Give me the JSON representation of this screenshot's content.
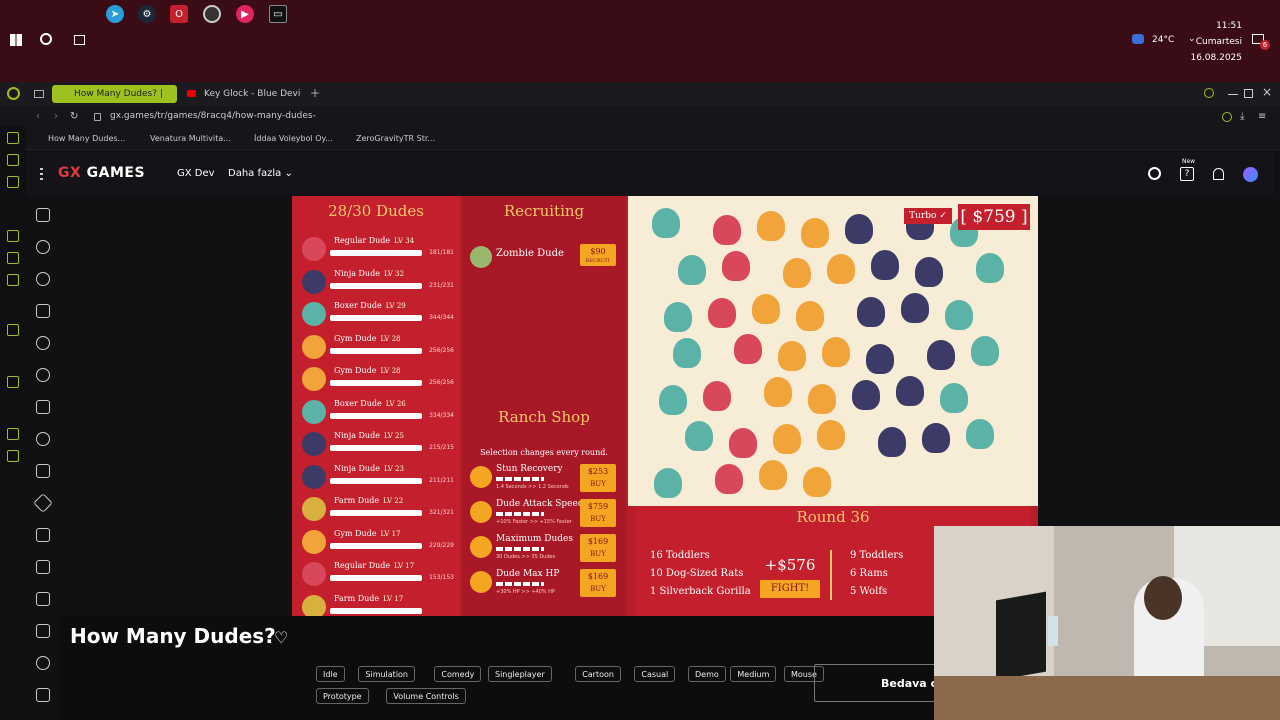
{
  "taskbar": {
    "time": "11:51",
    "day": "Cumartesi",
    "date": "16.08.2025",
    "temperature": "24°C",
    "notif_count": "6"
  },
  "browser": {
    "tabs": [
      {
        "label": "How Many Dudes? |"
      },
      {
        "label": "Key Glock - Blue Devil"
      }
    ],
    "url": "gx.games/tr/games/8racq4/how-many-dudes-",
    "bookmarks": [
      {
        "label": "How Many Dudes..."
      },
      {
        "label": "Venatura Multivita..."
      },
      {
        "label": "İddaa Voleybol Oy..."
      },
      {
        "label": "ZeroGravityTR Str..."
      }
    ]
  },
  "gx_header": {
    "logo_gx": "GX",
    "logo_games": " GAMES",
    "nav": [
      {
        "label": "GX Dev"
      },
      {
        "label": "Daha fazla"
      }
    ],
    "new_badge": "New"
  },
  "game": {
    "dudes_title": "28/30 Dudes",
    "dudes": [
      {
        "name": "Regular Dude",
        "lv": "LV 34",
        "hp": "181/181",
        "color": "#d8485a"
      },
      {
        "name": "Ninja Dude",
        "lv": "LV 32",
        "hp": "231/231",
        "color": "#3c3a66"
      },
      {
        "name": "Boxer Dude",
        "lv": "LV 29",
        "hp": "344/344",
        "color": "#5bb3a8"
      },
      {
        "name": "Gym Dude",
        "lv": "LV 28",
        "hp": "256/256",
        "color": "#f0a43a"
      },
      {
        "name": "Gym Dude",
        "lv": "LV 28",
        "hp": "256/256",
        "color": "#f0a43a"
      },
      {
        "name": "Boxer Dude",
        "lv": "LV 26",
        "hp": "334/334",
        "color": "#5bb3a8"
      },
      {
        "name": "Ninja Dude",
        "lv": "LV 25",
        "hp": "215/215",
        "color": "#3c3a66"
      },
      {
        "name": "Ninja Dude",
        "lv": "LV 23",
        "hp": "211/211",
        "color": "#3c3a66"
      },
      {
        "name": "Farm Dude",
        "lv": "LV 22",
        "hp": "321/321",
        "color": "#d8b040"
      },
      {
        "name": "Gym Dude",
        "lv": "LV 17",
        "hp": "229/229",
        "color": "#f0a43a"
      },
      {
        "name": "Regular Dude",
        "lv": "LV 17",
        "hp": "153/153",
        "color": "#d8485a"
      },
      {
        "name": "Farm Dude",
        "lv": "LV 17",
        "hp": "",
        "color": "#d8b040"
      }
    ],
    "recruiting_title": "Recruiting",
    "recruit_item": {
      "name": "Zombie Dude",
      "price": "$90",
      "action": "RECRUIT"
    },
    "ranch_title": "Ranch Shop",
    "ranch_subtitle": "Selection changes every round.",
    "shop": [
      {
        "name": "Stun Recovery",
        "desc": "1.4 Seconds >> 1.2 Seconds",
        "price": "$253",
        "action": "BUY"
      },
      {
        "name": "Dude Attack Speed",
        "desc": "+10% Faster >> +15% Faster",
        "price": "$759",
        "action": "BUY"
      },
      {
        "name": "Maximum Dudes",
        "desc": "30 Dudes >> 35 Dudes",
        "price": "$169",
        "action": "BUY"
      },
      {
        "name": "Dude Max HP",
        "desc": "+30% HP >> +40% HP",
        "price": "$169",
        "action": "BUY"
      }
    ],
    "turbo": "Turbo ✓",
    "money": "[ $759 ]",
    "round_title": "Round 36",
    "enemies_left": [
      {
        "label": "16 Toddlers"
      },
      {
        "label": "10 Dog-Sized Rats"
      },
      {
        "label": "1 Silverback Gorilla"
      }
    ],
    "reward": "+$576",
    "fight": "FIGHT!",
    "enemies_right": [
      {
        "label": "9 Toddlers"
      },
      {
        "label": "6 Rams"
      },
      {
        "label": "5 Wolfs"
      }
    ]
  },
  "game_page": {
    "title": "How Many Dudes?",
    "tags": [
      "Idle",
      "Simulation",
      "Comedy",
      "Singleplayer",
      "Cartoon",
      "Casual",
      "Demo",
      "Medium",
      "Mouse",
      "Prototype",
      "Volume Controls"
    ],
    "play_button": "Bedava oy"
  }
}
